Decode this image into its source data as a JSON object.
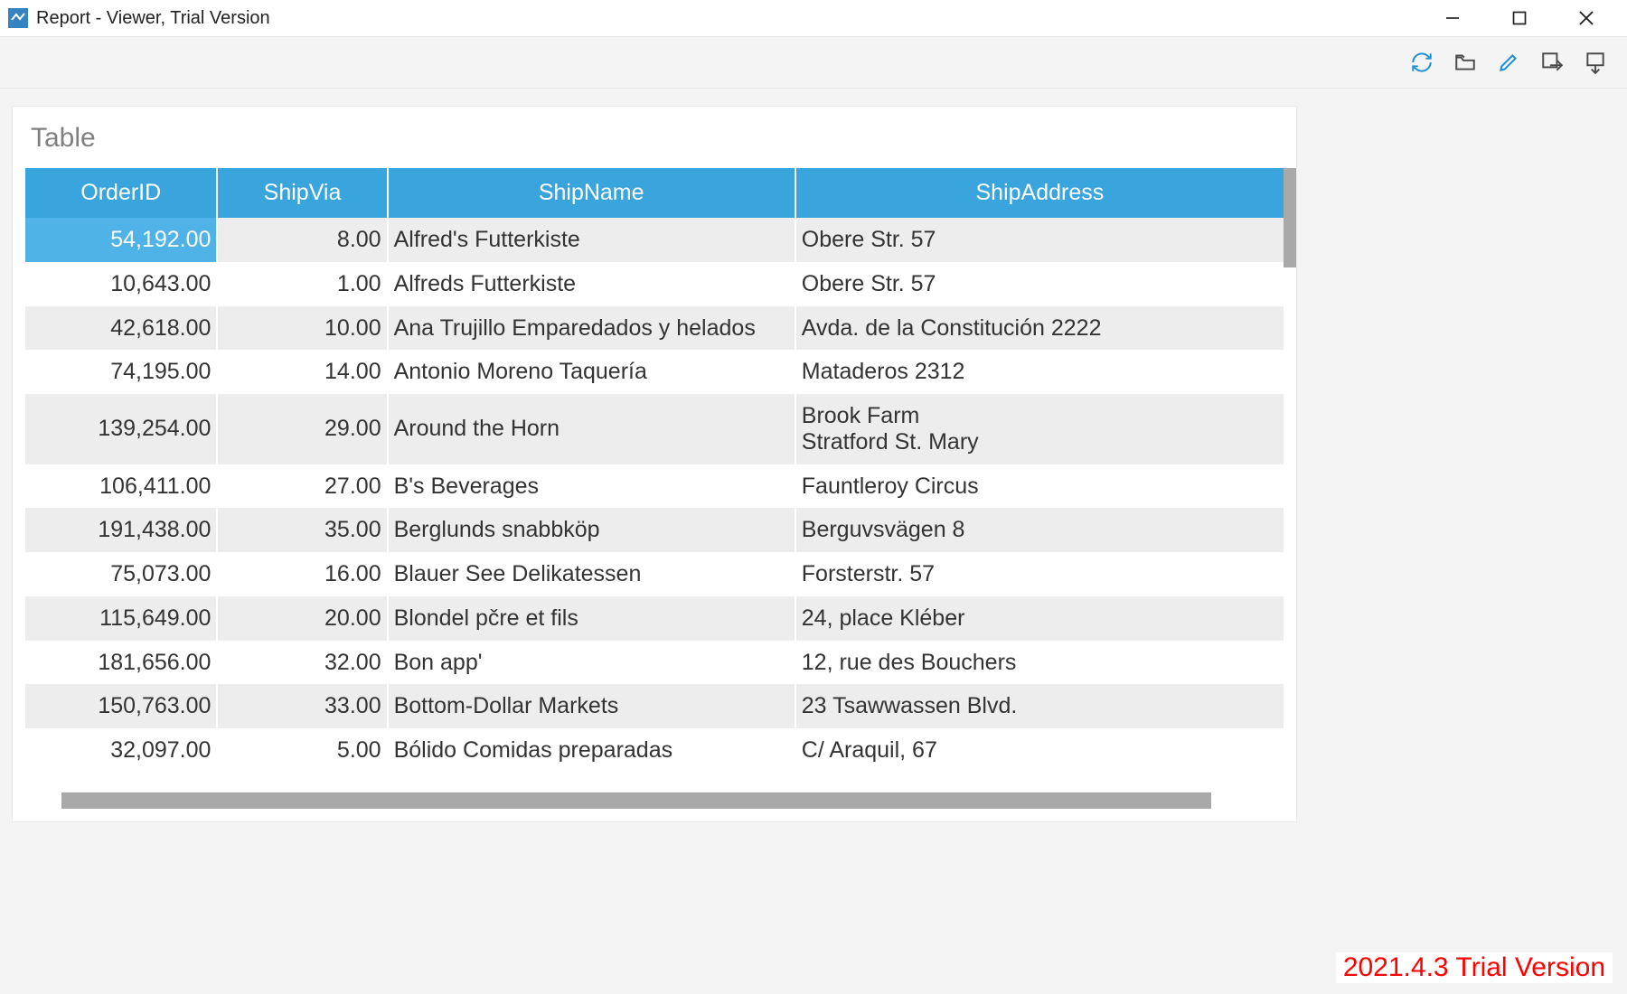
{
  "window": {
    "title": "Report - Viewer, Trial Version"
  },
  "toolbar": {
    "refresh_name": "refresh",
    "open_name": "open-folder",
    "edit_name": "edit-pencil",
    "export_name": "export",
    "print_name": "print"
  },
  "report": {
    "title": "Table",
    "columns": [
      "OrderID",
      "ShipVia",
      "ShipName",
      "ShipAddress"
    ],
    "selected_cell": {
      "row": 0,
      "col": 0
    },
    "rows": [
      {
        "order_id": "54,192.00",
        "ship_via": "8.00",
        "ship_name": "Alfred's Futterkiste",
        "ship_address": "Obere Str. 57"
      },
      {
        "order_id": "10,643.00",
        "ship_via": "1.00",
        "ship_name": "Alfreds Futterkiste",
        "ship_address": "Obere Str. 57"
      },
      {
        "order_id": "42,618.00",
        "ship_via": "10.00",
        "ship_name": "Ana Trujillo Emparedados y helados",
        "ship_address": "Avda. de la Constitución 2222"
      },
      {
        "order_id": "74,195.00",
        "ship_via": "14.00",
        "ship_name": "Antonio Moreno Taquería",
        "ship_address": "Mataderos  2312"
      },
      {
        "order_id": "139,254.00",
        "ship_via": "29.00",
        "ship_name": "Around the Horn",
        "ship_address": "Brook Farm\nStratford St. Mary"
      },
      {
        "order_id": "106,411.00",
        "ship_via": "27.00",
        "ship_name": "B's Beverages",
        "ship_address": "Fauntleroy Circus"
      },
      {
        "order_id": "191,438.00",
        "ship_via": "35.00",
        "ship_name": "Berglunds snabbköp",
        "ship_address": "Berguvsvägen  8"
      },
      {
        "order_id": "75,073.00",
        "ship_via": "16.00",
        "ship_name": "Blauer See Delikatessen",
        "ship_address": "Forsterstr. 57"
      },
      {
        "order_id": "115,649.00",
        "ship_via": "20.00",
        "ship_name": "Blondel pčre et fils",
        "ship_address": "24, place Kléber"
      },
      {
        "order_id": "181,656.00",
        "ship_via": "32.00",
        "ship_name": "Bon app'",
        "ship_address": "12, rue des Bouchers"
      },
      {
        "order_id": "150,763.00",
        "ship_via": "33.00",
        "ship_name": "Bottom-Dollar Markets",
        "ship_address": "23 Tsawwassen Blvd."
      },
      {
        "order_id": "32,097.00",
        "ship_via": "5.00",
        "ship_name": "Bólido Comidas preparadas",
        "ship_address": "C/ Araquil, 67"
      }
    ]
  },
  "footer": {
    "trial_text": "2021.4.3 Trial Version"
  }
}
